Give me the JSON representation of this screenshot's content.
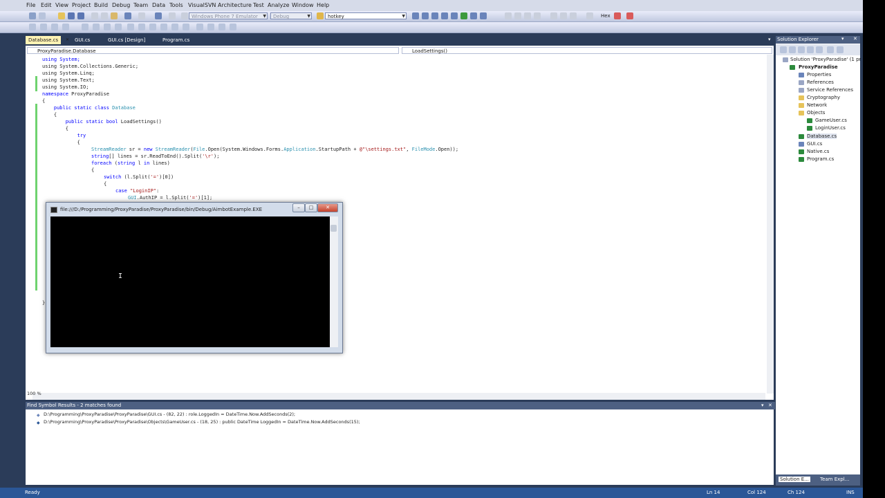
{
  "menu": [
    "File",
    "Edit",
    "View",
    "Project",
    "Build",
    "Debug",
    "Team",
    "Data",
    "Tools",
    "VisualSVN",
    "Architecture",
    "Test",
    "Analyze",
    "Window",
    "Help"
  ],
  "toolbar": {
    "platform_combo": "Windows Phone 7 Emulator",
    "config_combo": "Debug",
    "search_combo": "hotkey",
    "hex_label": "Hex"
  },
  "tabs": [
    "Database.cs",
    "GUI.cs",
    "GUI.cs [Design]",
    "Program.cs"
  ],
  "nav": {
    "class_combo": "ProxyParadise.Database",
    "member_combo": "LoadSettings()"
  },
  "code": {
    "l1": "using System;",
    "l2": "using System.Collections.Generic;",
    "l3": "using System.Linq;",
    "l4": "using System.Text;",
    "l5": "using System.IO;",
    "l6a": "namespace",
    "l6b": " ProxyParadise",
    "l7": "{",
    "l8a": "    public static class ",
    "l8b": "Database",
    "l9": "    {",
    "l10a": "        public static bool ",
    "l10b": "LoadSettings()",
    "l11": "        {",
    "l12": "            try",
    "l13": "            {",
    "l14a": "StreamReader",
    "l14b": " sr = ",
    "l14c": "new ",
    "l14d": "StreamReader",
    "l14e": "(",
    "l14f": "File",
    "l14g": ".Open(System.Windows.Forms.",
    "l14h": "Application",
    "l14i": ".StartupPath + ",
    "l14j": "@\"\\settings.txt\"",
    "l14k": ", ",
    "l14l": "FileMode",
    "l14m": ".Open));",
    "l15a": "string",
    "l15b": "[] lines = sr.ReadToEnd().Split(",
    "l15c": "'\\r'",
    "l15d": ");",
    "l16a": "foreach",
    "l16b": " (",
    "l16c": "string",
    "l16d": " l ",
    "l16e": "in",
    "l16f": " lines)",
    "l17": "{",
    "l18a": "switch",
    "l18b": " (l.Split(",
    "l18c": "'='",
    "l18d": ")[0])",
    "l19": "{",
    "l20a": "case ",
    "l20b": "\"LoginIP\"",
    "l20c": ":",
    "l21a": "GUI",
    "l21b": ".AuthIP = l.Split(",
    "l21c": "'='",
    "l21d": ")[1];",
    "l22": "}"
  },
  "zoom": "100 %",
  "console": {
    "title": "file:///D:/Programming/ProxyParadise/ProxyParadise/bin/Debug/AimbotExample.EXE"
  },
  "find": {
    "title": "Find Symbol Results - 2 matches found",
    "results": [
      "D:\\Programming\\ProxyParadise\\ProxyParadise\\GUI.cs - (82, 22) : role.LoggedIn = DateTime.Now.AddSeconds(2);",
      "D:\\Programming\\ProxyParadise\\ProxyParadise\\Objects\\GameUser.cs - (18, 25) : public DateTime LoggedIn = DateTime.Now.AddSeconds(15);"
    ]
  },
  "solution": {
    "title": "Solution Explorer",
    "items": [
      "Solution 'ProxyParadise' (1 pr",
      "ProxyParadise",
      "Properties",
      "References",
      "Service References",
      "Cryptography",
      "Network",
      "Objects",
      "GameUser.cs",
      "LoginUser.cs",
      "Database.cs",
      "GUI.cs",
      "Native.cs",
      "Program.cs"
    ],
    "bottom_tabs": [
      "Solution E...",
      "Team Expl..."
    ]
  },
  "status": {
    "text": "Ready",
    "ln": "Ln 14",
    "col": "Col 124",
    "ch": "Ch 124",
    "ins": "INS"
  }
}
